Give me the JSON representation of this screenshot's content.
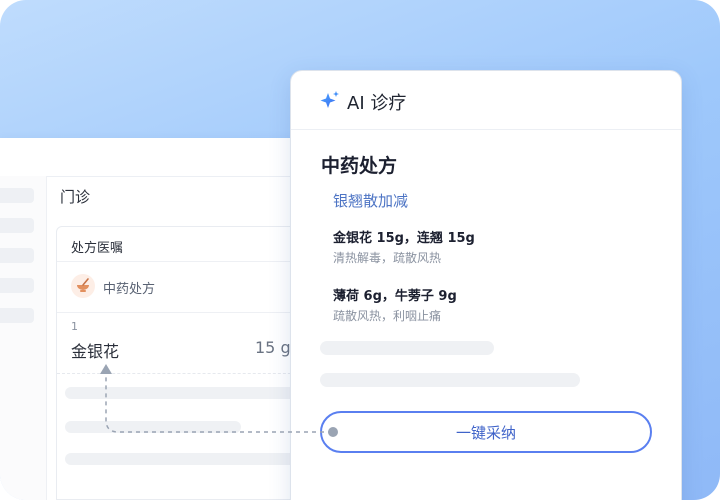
{
  "clinic": {
    "section_title": "门诊",
    "prescription_card": {
      "title": "处方医嘱",
      "category": "中药处方",
      "first_item": {
        "index": "1",
        "name": "金银花",
        "dose": "15 g"
      }
    }
  },
  "ai_panel": {
    "icon": "sparkle-icon",
    "title": "AI 诊疗",
    "section_title": "中药处方",
    "formula_name": "银翘散加减",
    "herbs": [
      {
        "line": "金银花 15g，连翘 15g",
        "effect": "清热解毒，疏散风热"
      },
      {
        "line": "薄荷 6g，牛蒡子 9g",
        "effect": "疏散风热，利咽止痛"
      }
    ],
    "adopt_label": "一键采纳"
  },
  "colors": {
    "accent": "#5a7ff0",
    "accent_text": "#3f63c9",
    "formula_blue": "#4d74c4",
    "background_blue": "#9ec8fb"
  }
}
